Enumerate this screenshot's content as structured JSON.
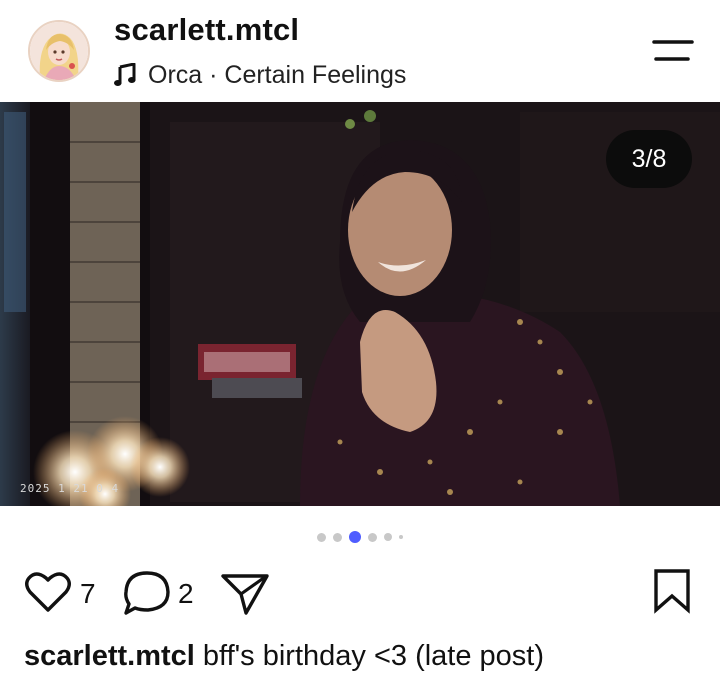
{
  "post": {
    "username": "scarlett.mtcl",
    "music": "Orca · Certain Feelings",
    "image_counter": "3/8",
    "timestamp_overlay": "2025  1  21  0  4",
    "carousel": {
      "total_dots": 6,
      "active_index": 2
    },
    "likes": "7",
    "comments": "2",
    "caption_user": "scarlett.mtcl",
    "caption_text": "bff's birthday <3 (late post)"
  },
  "icons": {
    "music": "music-note-icon",
    "menu": "menu-icon",
    "like": "heart-icon",
    "comment": "comment-bubble-icon",
    "share": "send-icon",
    "save": "bookmark-icon"
  },
  "colors": {
    "accent": "#4f5dff",
    "dot_inactive": "#c8c8c8",
    "text": "#111111"
  }
}
